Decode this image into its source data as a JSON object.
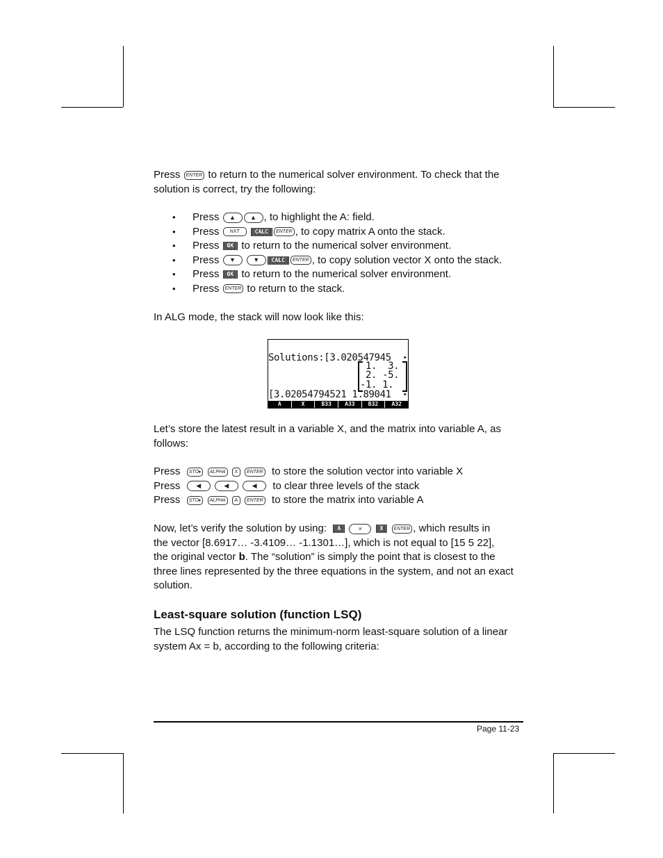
{
  "paragraph1": {
    "prefix": "Press",
    "key": "ENTER",
    "suffix_line1": "to return to the numerical solver environment.  To check that the",
    "line2": "solution is correct, try the following:"
  },
  "bullets": [
    {
      "prefix": "Press",
      "keys": [
        "▲",
        "▲"
      ],
      "suffix": ", to highlight the A: field."
    },
    {
      "prefix": "Press",
      "keys": [
        "NXT"
      ],
      "softkeys": [
        "CALC"
      ],
      "keys2": [
        "ENTER"
      ],
      "suffix": ", to copy matrix A onto the stack."
    },
    {
      "prefix": "Press",
      "softkeys": [
        "OK"
      ],
      "suffix": "to return to the numerical solver environment."
    },
    {
      "prefix": "Press",
      "keys": [
        "▼",
        "▼"
      ],
      "softkeys": [
        "CALC"
      ],
      "keys2": [
        "ENTER"
      ],
      "suffix": ", to copy solution vector X onto the stack."
    },
    {
      "prefix": "Press",
      "softkeys": [
        "OK"
      ],
      "suffix": "to return to the numerical solver environment."
    },
    {
      "prefix": "Press",
      "keys": [
        "ENTER"
      ],
      "suffix": "to return to the stack."
    }
  ],
  "bullet_symbol": "•",
  "alg_intro": "In ALG mode, the stack will now look like this:",
  "screen": {
    "line1": "Solutions:[3.020547945",
    "matrix": [
      "1.  3.",
      "2. -5.",
      "-1. 1."
    ],
    "line_bottom": "[3.02054794521 1.89041",
    "overflow_arrow": "▸",
    "menu": [
      "A",
      "X",
      "B33",
      "A33",
      "B32",
      "A32"
    ]
  },
  "store_intro": {
    "line1": "Let’s store the latest result in a variable X, and the matrix into variable A, as",
    "line2": "follows:"
  },
  "store_steps": [
    {
      "prefix": "Press",
      "keys": [
        "STO▸",
        "ALPHA",
        "X",
        "ENTER"
      ],
      "suffix": "to store the solution vector into variable X"
    },
    {
      "prefix": "Press",
      "keys": [
        "◀",
        "◀",
        "◀"
      ],
      "suffix": "to clear three levels of the stack"
    },
    {
      "prefix": "Press",
      "keys": [
        "STO▸",
        "ALPHA",
        "A",
        "ENTER"
      ],
      "suffix": "to store the matrix into variable A"
    }
  ],
  "verify": {
    "prefix": "Now, let’s verify the solution by using:",
    "softkey1": "A",
    "key_times": "×",
    "softkey2": "X",
    "key_enter": "ENTER",
    "suffix": ", which results in",
    "line2": "the vector [8.6917… -3.4109… -1.1301…], which is not equal to [15 5 22],",
    "line3_pre": "the original vector ",
    "line3_bold": "b",
    "line3_post": ".  The “solution” is simply the point that is closest to the",
    "line4": "three lines represented by the three equations in the system, and not an exact",
    "line5": "solution."
  },
  "section": {
    "heading": "Least-square solution (function LSQ)",
    "line1": "The LSQ function returns the minimum-norm least-square solution of a linear",
    "line2": "system Ax = b, according to the following criteria:"
  },
  "footer": {
    "page": "Page 11-23"
  }
}
